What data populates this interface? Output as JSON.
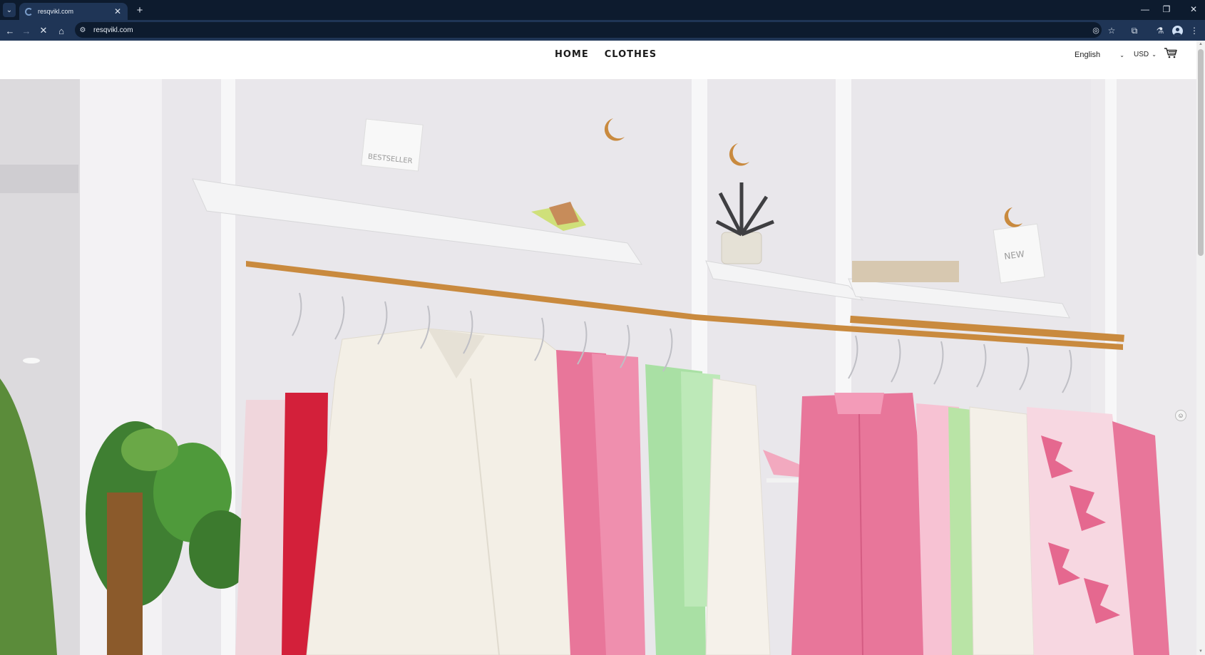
{
  "browser": {
    "tab": {
      "title": "resqvikl.com",
      "close_glyph": "✕",
      "favicon": "loading-spinner-icon"
    },
    "tab_list_glyph": "⌄",
    "new_tab_glyph": "+",
    "window_controls": {
      "minimize": "—",
      "restore": "❐",
      "close": "✕"
    },
    "nav": {
      "back": "←",
      "forward": "→",
      "stop": "✕",
      "home": "⌂"
    },
    "omnibox": {
      "url": "resqvikl.com",
      "site_info_glyph": "⚙"
    },
    "toolbar_icons": {
      "eye_off": "◎",
      "bookmark": "☆",
      "extensions": "⧉",
      "labs": "⚗",
      "menu": "⋮"
    }
  },
  "site": {
    "nav": {
      "home": "HOME",
      "clothes": "CLOTHES"
    },
    "language": {
      "selected": "English",
      "chevron": "⌄"
    },
    "currency": {
      "selected": "USD",
      "chevron": "⌄"
    },
    "hero": {
      "shelf_sign_1": "BESTSELLER",
      "shelf_sign_2": "NEW"
    }
  },
  "colors": {
    "tabbar_bg": "#0d1b2e",
    "toolbar_bg": "#1f3556",
    "rail_gold": "#c98a3e",
    "pink": "#e8769a",
    "cream": "#f3efe6",
    "green": "#a9e0a4",
    "red": "#d3203a"
  }
}
